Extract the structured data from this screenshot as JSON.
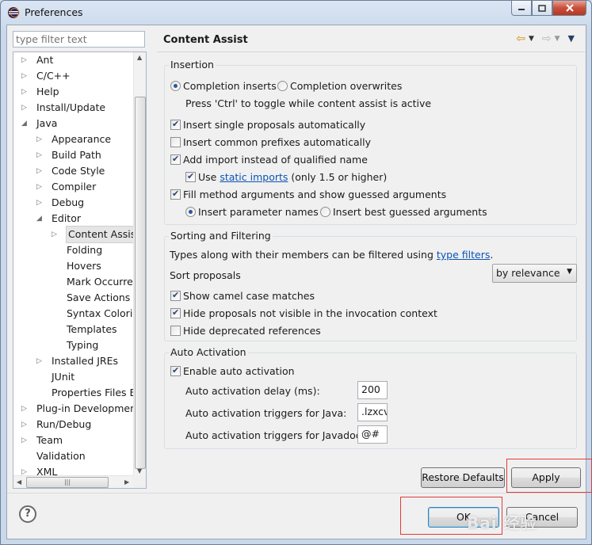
{
  "window": {
    "title": "Preferences",
    "minimize_icon": "minimize-icon",
    "maximize_icon": "maximize-icon",
    "close_icon": "close-icon"
  },
  "filter": {
    "placeholder": "type filter text",
    "value": "type filter text"
  },
  "tree": [
    {
      "label": "Ant",
      "level": 0,
      "arrow": "▷"
    },
    {
      "label": "C/C++",
      "level": 0,
      "arrow": "▷"
    },
    {
      "label": "Help",
      "level": 0,
      "arrow": "▷"
    },
    {
      "label": "Install/Update",
      "level": 0,
      "arrow": "▷"
    },
    {
      "label": "Java",
      "level": 0,
      "arrow": "◢"
    },
    {
      "label": "Appearance",
      "level": 1,
      "arrow": "▷"
    },
    {
      "label": "Build Path",
      "level": 1,
      "arrow": "▷"
    },
    {
      "label": "Code Style",
      "level": 1,
      "arrow": "▷"
    },
    {
      "label": "Compiler",
      "level": 1,
      "arrow": "▷"
    },
    {
      "label": "Debug",
      "level": 1,
      "arrow": "▷"
    },
    {
      "label": "Editor",
      "level": 1,
      "arrow": "◢"
    },
    {
      "label": "Content Assist",
      "level": 2,
      "arrow": "▷",
      "selected": true
    },
    {
      "label": "Folding",
      "level": 2,
      "arrow": ""
    },
    {
      "label": "Hovers",
      "level": 2,
      "arrow": ""
    },
    {
      "label": "Mark Occurren",
      "level": 2,
      "arrow": ""
    },
    {
      "label": "Save Actions",
      "level": 2,
      "arrow": ""
    },
    {
      "label": "Syntax Coloring",
      "level": 2,
      "arrow": ""
    },
    {
      "label": "Templates",
      "level": 2,
      "arrow": ""
    },
    {
      "label": "Typing",
      "level": 2,
      "arrow": ""
    },
    {
      "label": "Installed JREs",
      "level": 1,
      "arrow": "▷"
    },
    {
      "label": "JUnit",
      "level": 1,
      "arrow": ""
    },
    {
      "label": "Properties Files Ed",
      "level": 1,
      "arrow": ""
    },
    {
      "label": "Plug-in Development",
      "level": 0,
      "arrow": "▷"
    },
    {
      "label": "Run/Debug",
      "level": 0,
      "arrow": "▷"
    },
    {
      "label": "Team",
      "level": 0,
      "arrow": "▷"
    },
    {
      "label": "Validation",
      "level": 0,
      "arrow": ""
    },
    {
      "label": "XML",
      "level": 0,
      "arrow": "▷"
    }
  ],
  "page": {
    "title": "Content Assist",
    "insertion": {
      "title": "Insertion",
      "completion_inserts": "Completion inserts",
      "completion_overwrites": "Completion overwrites",
      "toggle_hint": "Press 'Ctrl' to toggle while content assist is active",
      "insert_single": "Insert single proposals automatically",
      "insert_common": "Insert common prefixes automatically",
      "add_import": "Add import instead of qualified name",
      "use_prefix": "Use ",
      "static_imports": "static imports",
      "use_suffix": " (only 1.5 or higher)",
      "fill_method": "Fill method arguments and show guessed arguments",
      "insert_param_names": "Insert parameter names",
      "insert_best_guessed": "Insert best guessed arguments"
    },
    "sorting": {
      "title": "Sorting and Filtering",
      "types_prefix": "Types along with their members can be filtered using ",
      "type_filters": "type filters",
      "types_suffix": ".",
      "sort_proposals": "Sort proposals",
      "sort_value": "by relevance",
      "show_camel": "Show camel case matches",
      "hide_not_visible": "Hide proposals not visible in the invocation context",
      "hide_deprecated": "Hide deprecated references"
    },
    "auto_activation": {
      "title": "Auto Activation",
      "enable": "Enable auto activation",
      "delay_label": "Auto activation delay (ms):",
      "delay_value": "200",
      "java_label": "Auto activation triggers for Java:",
      "java_value": ".lzxcvl",
      "javadoc_label": "Auto activation triggers for Javadoc:",
      "javadoc_value": "@#"
    }
  },
  "buttons": {
    "restore_defaults": "Restore Defaults",
    "apply": "Apply",
    "ok": "OK",
    "cancel": "Cancel"
  },
  "watermark": "Bai 经验"
}
